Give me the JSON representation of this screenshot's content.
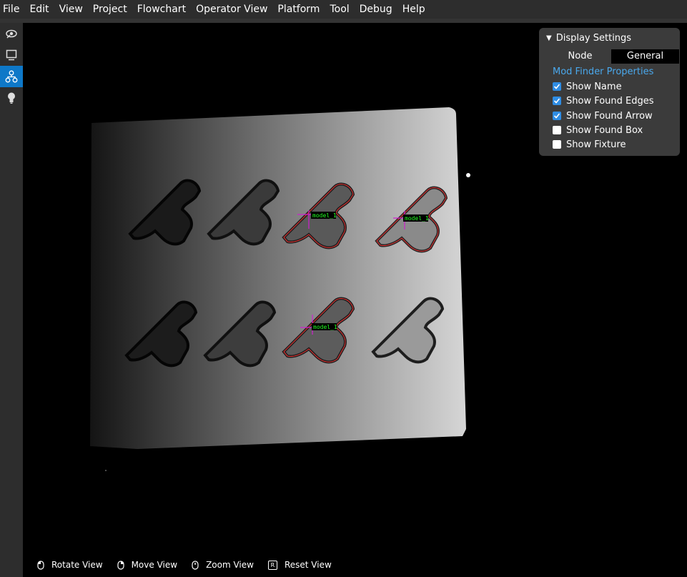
{
  "menu": [
    "File",
    "Edit",
    "View",
    "Project",
    "Flowchart",
    "Operator View",
    "Platform",
    "Tool",
    "Debug",
    "Help"
  ],
  "sidebar": {
    "icons": [
      "eye-camera-icon",
      "monitor-icon",
      "flowchart-nodes-icon",
      "lightbulb-icon"
    ],
    "active_index": 2
  },
  "display_settings": {
    "title": "Display Settings",
    "tabs": {
      "node": "Node",
      "general": "General",
      "active": "General"
    },
    "section_title": "Mod Finder Properties",
    "options": [
      {
        "label": "Show Name",
        "checked": true
      },
      {
        "label": "Show Found Edges",
        "checked": true
      },
      {
        "label": "Show Found Arrow",
        "checked": true
      },
      {
        "label": "Show Found Box",
        "checked": false
      },
      {
        "label": "Show Fixture",
        "checked": false
      }
    ]
  },
  "viewport": {
    "detection_labels": [
      "model_1",
      "model_1",
      "model_1"
    ]
  },
  "view_controls": {
    "rotate": "Rotate View",
    "move": "Move View",
    "zoom": "Zoom View",
    "reset": "Reset View",
    "reset_key": "R"
  },
  "colors": {
    "accent": "#0e78c8",
    "section_title": "#4aa8ec",
    "found_edges": "#e53030",
    "label_text": "#22ff22"
  }
}
